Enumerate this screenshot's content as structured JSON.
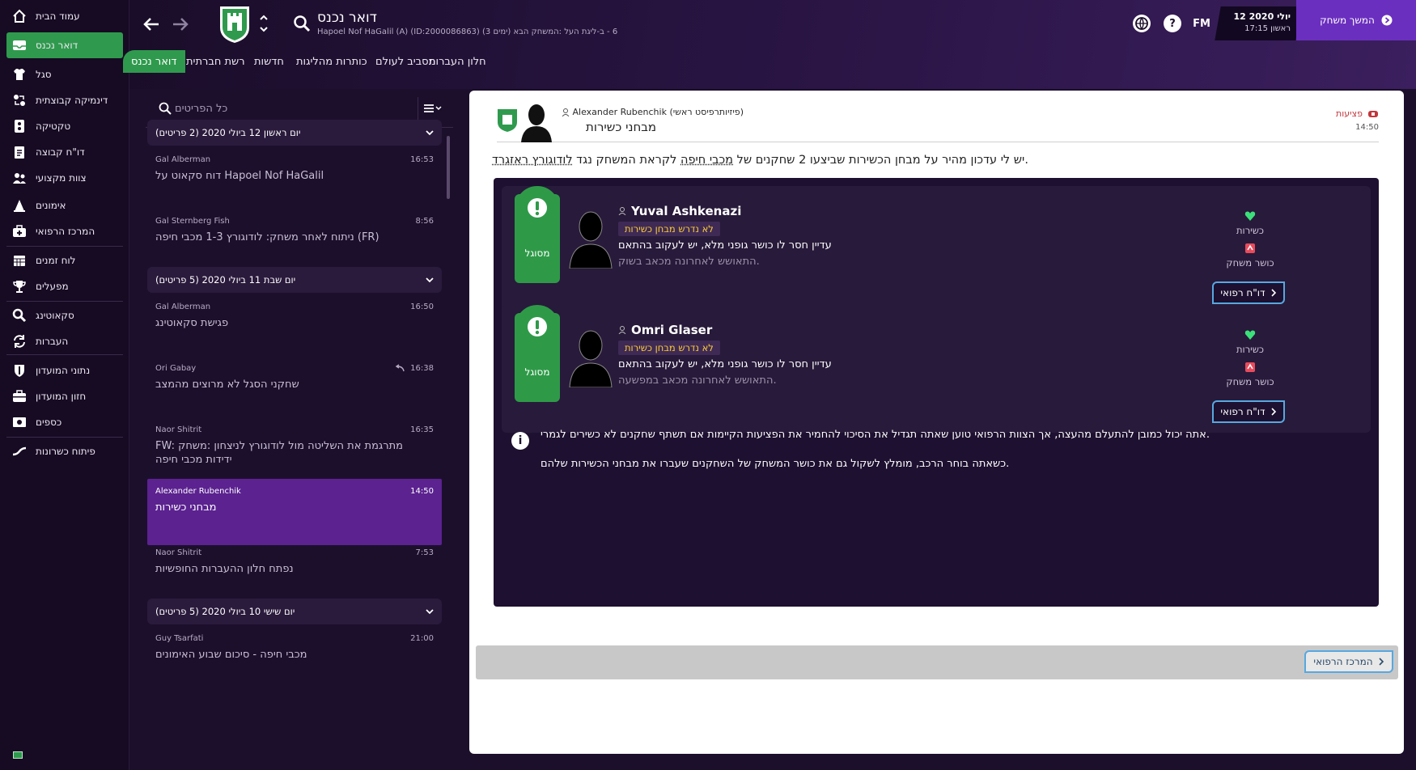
{
  "sidebar": {
    "items": [
      {
        "label": "עמוד הבית",
        "icon": "home-icon",
        "glyph": "⌂"
      },
      {
        "label": "דואר נכנס",
        "icon": "inbox-icon",
        "glyph": "✉"
      },
      {
        "label": "סגל",
        "icon": "squad-shirt-icon",
        "glyph": "👕"
      },
      {
        "label": "דינמיקה קבוצתית",
        "icon": "dynamics-icon",
        "glyph": "⇄"
      },
      {
        "label": "טקטיקה",
        "icon": "tactics-board-icon",
        "glyph": "▦"
      },
      {
        "label": "דו\"ח קבוצה",
        "icon": "team-report-icon",
        "glyph": "▤"
      },
      {
        "label": "צוות מקצועי",
        "icon": "staff-icon",
        "glyph": "👥"
      },
      {
        "label": "אימונים",
        "icon": "training-cone-icon",
        "glyph": "▲"
      },
      {
        "label": "המרכז הרפואי",
        "icon": "medical-kit-icon",
        "glyph": "✚"
      },
      {
        "label": "לוח זמנים",
        "icon": "calendar-icon",
        "glyph": "▦"
      },
      {
        "label": "מפעלים",
        "icon": "trophy-icon",
        "glyph": "🏆"
      },
      {
        "label": "סקאוטינג",
        "icon": "scouting-magnifier-icon",
        "glyph": "⚲"
      },
      {
        "label": "העברות",
        "icon": "transfers-icon",
        "glyph": "⟲"
      },
      {
        "label": "נתוני המועדון",
        "icon": "club-info-shield-icon",
        "glyph": "⛉"
      },
      {
        "label": "חזון המועדון",
        "icon": "club-vision-briefcase-icon",
        "glyph": "💼"
      },
      {
        "label": "כספים",
        "icon": "finances-icon",
        "glyph": "💵"
      },
      {
        "label": "פיתוח כשרונות",
        "icon": "development-icon",
        "glyph": "〰"
      }
    ]
  },
  "header": {
    "title": "דואר נכנס",
    "subtitle": "Hapoel Nof HaGalil (A) (ID:2000086863) (3 ימים) 6 - ב-ליגת העל :המשחק הבא",
    "tabs": [
      "דואר נכנס",
      "רשת חברתית",
      "חדשות",
      "כותרות מהליגות",
      "מסביב לעולם",
      "חלון העברות"
    ],
    "fm_label": "FM",
    "date_main": "12 יולי 2020",
    "date_sub": "ראשון 17:15",
    "continue_label": "המשך משחק"
  },
  "inbox": {
    "search_placeholder": "כל הפריטים",
    "groups": [
      {
        "header": "יום ראשון 12 ביולי 2020 (2 פריטים)",
        "messages": [
          {
            "sender": "Gal Alberman",
            "time": "16:53",
            "subject": "דוח סקאוט על Hapoel Nof HaGalil"
          },
          {
            "sender": "Gal Sternberg Fish",
            "time": "8:56",
            "subject": "ניתוח לאחר משחק: לודוגורץ 1-3 מכבי חיפה (FR)"
          }
        ]
      },
      {
        "header": "יום שבת 11 ביולי 2020 (5 פריטים)",
        "messages": [
          {
            "sender": "Gal Alberman",
            "time": "16:50",
            "subject": "פגישת סקאוטינג"
          },
          {
            "sender": "Ori Gabay",
            "time": "16:38",
            "subject": "שחקני הסגל לא מרוצים מהמצב"
          },
          {
            "sender": "Naor Shitrit",
            "time": "16:35",
            "subject": "FW: מתרגמת את השליטה מול לודוגורץ לניצחון :משחק ידידות מכבי חיפה"
          },
          {
            "sender": "Alexander Rubenchik",
            "time": "14:50",
            "subject": "מבחני כשירות"
          },
          {
            "sender": "Naor Shitrit",
            "time": "7:53",
            "subject": "נפתח חלון ההעברות החופשיות"
          }
        ]
      },
      {
        "header": "יום שישי 10 ביולי 2020 (5 פריטים)",
        "messages": [
          {
            "sender": "Guy Tsarfati",
            "time": "21:00",
            "subject": "מכבי חיפה - סיכום שבוע האימונים"
          }
        ]
      }
    ]
  },
  "message": {
    "sender_name": "Alexander Rubenchik",
    "sender_role": "(פיזיותרפיסט ראשי)",
    "subject": "מבחני כשירות",
    "category_tag": "פציעות",
    "time": "14:50",
    "intro_before": "יש לי עדכון מהיר על מבחן הכשירות שביצעו 2 שחקנים של ",
    "intro_club": "מכבי חיפה",
    "intro_middle": " לקראת המשחק נגד ",
    "intro_opponent": "לודוגורץ ראזגרד",
    "intro_end": ".",
    "players": [
      {
        "status": "מסוגל",
        "name": "Yuval Ashkenazi",
        "fitness_test": "לא נדרש מבחן כשירות",
        "line1": "עדיין חסר לו כושר גופני מלא, יש לעקוב בהתאם",
        "line2": "התאושש לאחרונה מכאב בשוק.",
        "stat1": "כשירות",
        "stat2": "כושר משחק",
        "report_label": "דו\"ח רפואי"
      },
      {
        "status": "מסוגל",
        "name": "Omri Glaser",
        "fitness_test": "לא נדרש מבחן כשירות",
        "line1": "עדיין חסר לו כושר גופני מלא, יש לעקוב בהתאם",
        "line2": "התאושש לאחרונה מכאב במפשעה.",
        "stat1": "כשירות",
        "stat2": "כושר משחק",
        "report_label": "דו\"ח רפואי"
      }
    ],
    "info_line1": "אתה יכול כמובן להתעלם מהעצה, אך הצוות הרפואי טוען שאתה תגדיל את הסיכוי להחמיר את הפציעות הקיימות אם תשתף שחקנים לא כשירים לגמרי.",
    "info_line2": "כשאתה בוחר הרכב, מומלץ לשקול גם את כושר המשחק של השחקנים שעברו את מבחני הכשירות שלהם.",
    "footer_button": "המרכז הרפואי"
  },
  "colors": {
    "accent_green": "#2f9a4d",
    "purple_button": "#6b2fbf",
    "active_message": "#5b2290",
    "injury_red": "#c2363b",
    "fitness_yellow": "#ffcc33",
    "button_border_blue": "#57a8e0"
  }
}
